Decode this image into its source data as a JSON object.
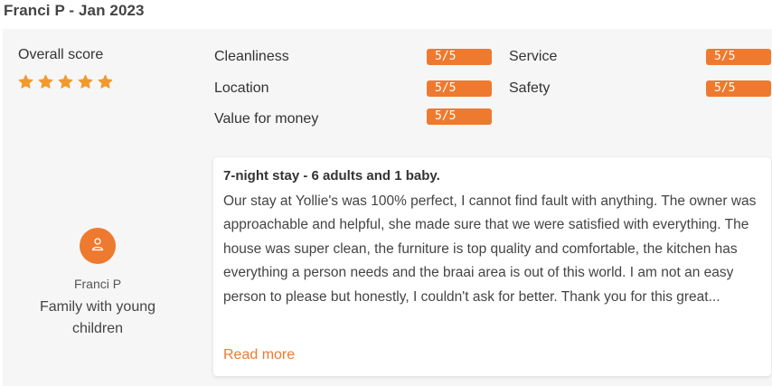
{
  "review": {
    "title": "Franci P - Jan 2023",
    "overall_label": "Overall score",
    "stars": 5,
    "star_color": "#f2992e",
    "accent_color": "#ee7a2f",
    "ratings": [
      {
        "label": "Cleanliness",
        "score": "5/5"
      },
      {
        "label": "Service",
        "score": "5/5"
      },
      {
        "label": "Location",
        "score": "5/5"
      },
      {
        "label": "Safety",
        "score": "5/5"
      },
      {
        "label": "Value for money",
        "score": "5/5"
      }
    ],
    "card": {
      "heading": "7-night stay - 6 adults and 1 baby.",
      "body": "Our stay at Yollie's was 100% perfect, I cannot find fault with anything. The owner was approachable and helpful, she made sure that we were satisfied with everything. The house was super clean, the furniture is top quality and comfortable, the kitchen has everything a person needs and the braai area is out of this world. I am not an easy person to please but honestly, I couldn't ask for better. Thank you for this great...",
      "read_more": "Read more"
    },
    "reviewer": {
      "name": "Franci P",
      "type": "Family with young children",
      "avatar_icon": "user-icon"
    }
  }
}
